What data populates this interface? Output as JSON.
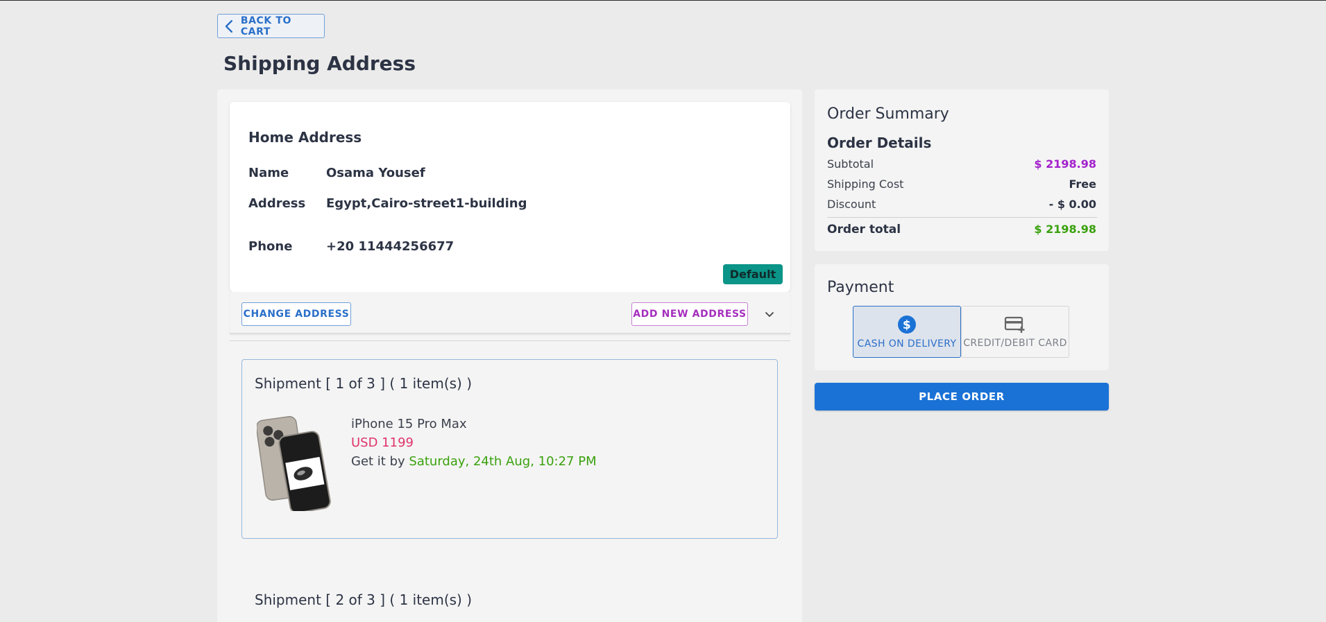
{
  "nav": {
    "back_label": "BACK TO CART"
  },
  "page": {
    "title": "Shipping Address"
  },
  "address": {
    "card_title": "Home Address",
    "name_label": "Name",
    "name_value": "Osama Yousef",
    "address_label": "Address",
    "address_value": "Egypt,Cairo-street1-building",
    "phone_label": "Phone",
    "phone_value": "+20 11444256677",
    "badge": "Default",
    "change_label": "CHANGE ADDRESS",
    "add_new_label": "ADD NEW ADDRESS"
  },
  "shipments": [
    {
      "title": "Shipment [ 1 of 3 ] ( 1 item(s) )",
      "product_name": "iPhone 15 Pro Max",
      "price": "USD 1199",
      "eta_prefix": "Get it by ",
      "eta_date": "Saturday, 24th Aug, 10:27 PM"
    },
    {
      "title": "Shipment [ 2 of 3 ] ( 1 item(s) )"
    }
  ],
  "summary": {
    "heading": "Order Summary",
    "subheading": "Order Details",
    "subtotal_label": "Subtotal",
    "subtotal_value": "$ 2198.98",
    "shipping_label": "Shipping Cost",
    "shipping_value": "Free",
    "discount_label": "Discount",
    "discount_value": "- $ 0.00",
    "total_label": "Order total",
    "total_value": "$ 2198.98"
  },
  "payment": {
    "heading": "Payment",
    "cash_label": "CASH ON DELIVERY",
    "card_label": "CREDIT/DEBIT CARD",
    "selected": "cash"
  },
  "place_order_label": "PLACE ORDER",
  "colors": {
    "primary": "#1b72d6",
    "subtotal": "#a322cc",
    "total": "#3aa10e",
    "price": "#e0336b",
    "default_badge": "#0b9488"
  }
}
